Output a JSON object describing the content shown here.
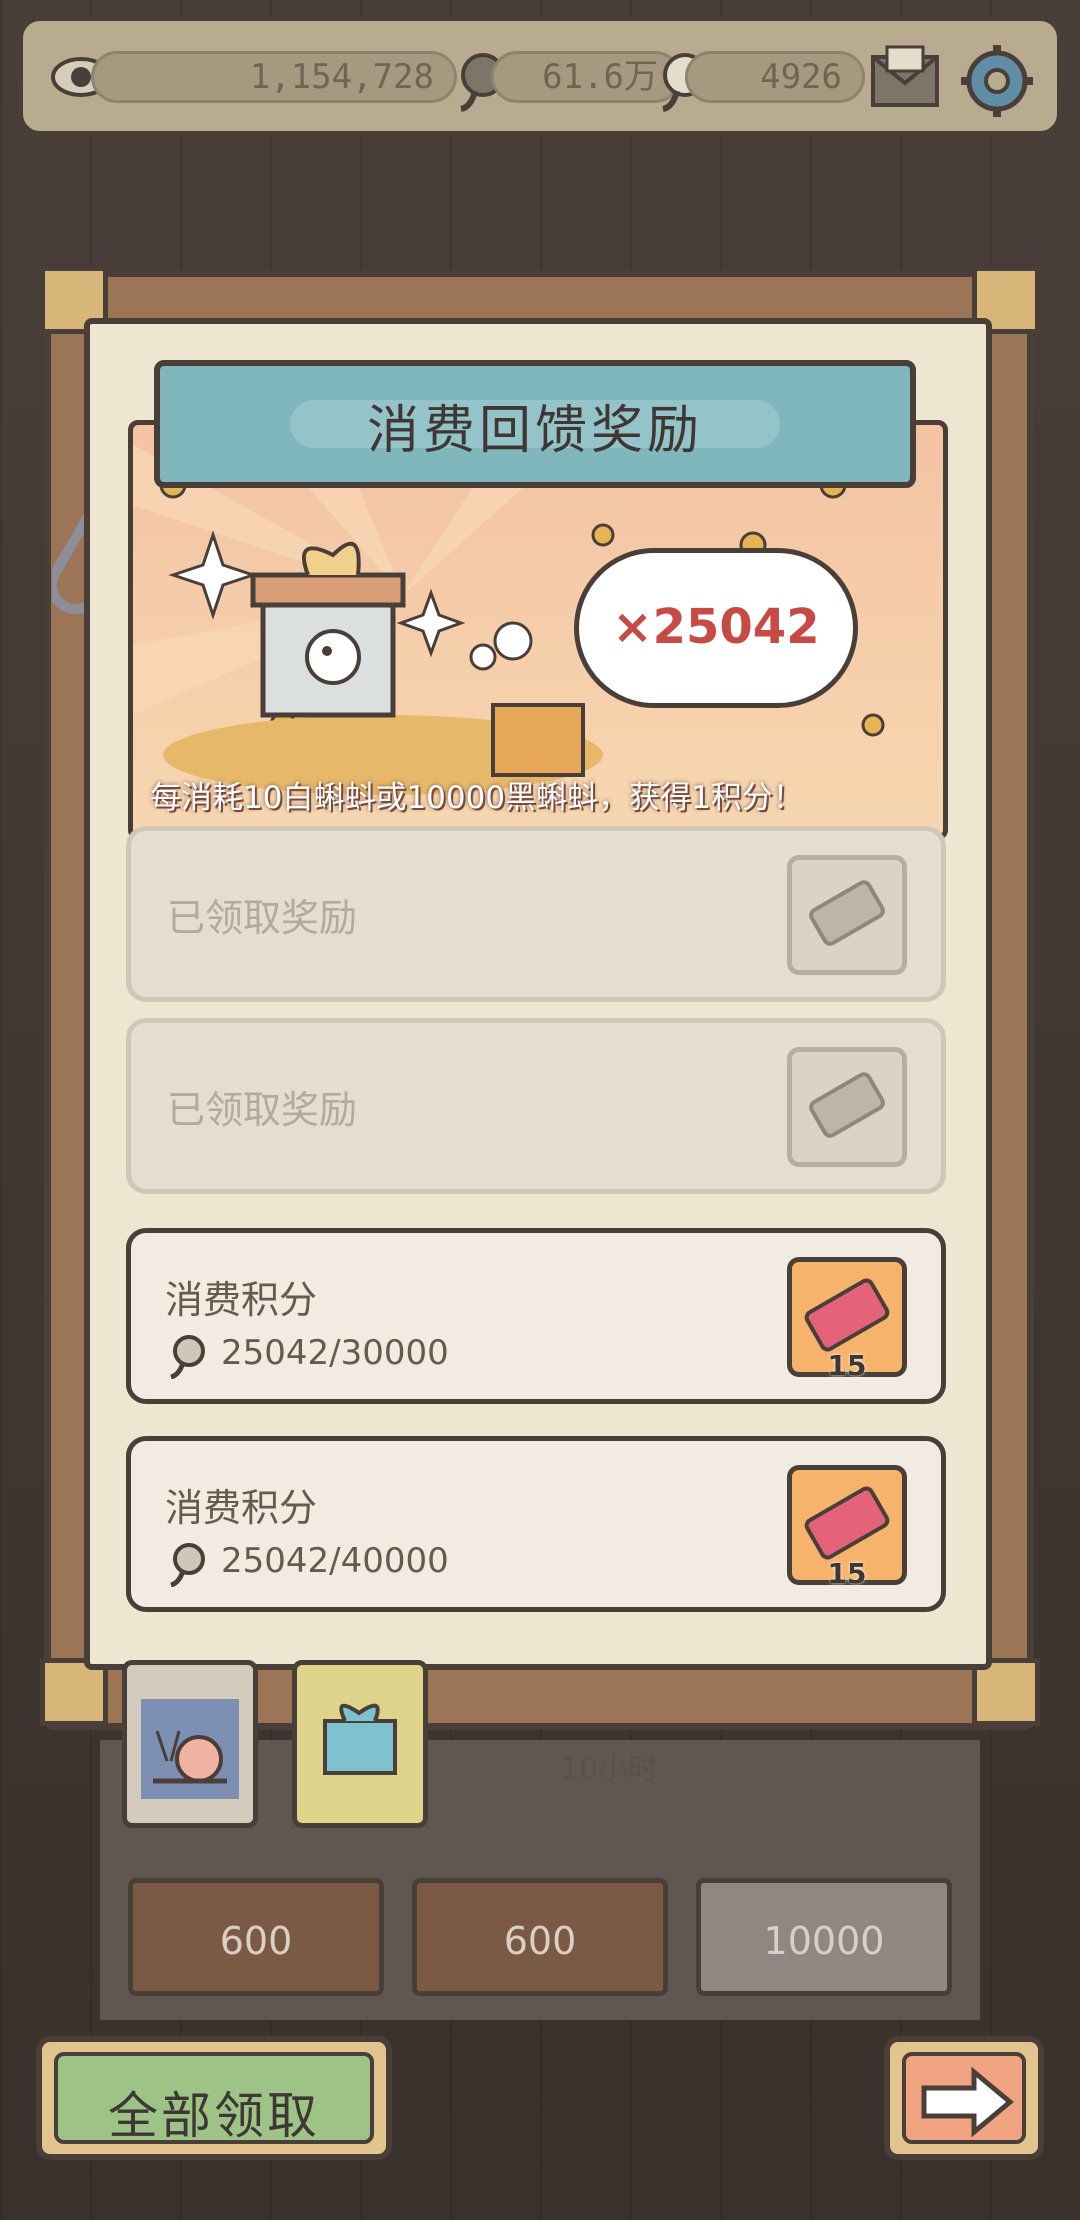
{
  "topbar": {
    "views": "1,154,728",
    "black_tadpoles": "61.6万",
    "white_tadpoles": "4926"
  },
  "panel": {
    "title": "消费回馈奖励",
    "points_total": "×25042",
    "info": "每消耗10白蝌蚪或10000黑蝌蚪，获得1积分！"
  },
  "rows": [
    {
      "label": "已领取奖励"
    },
    {
      "label": "已领取奖励"
    },
    {
      "title": "消费积分",
      "progress": "25042/30000",
      "reward_count": "15"
    },
    {
      "title": "消费积分",
      "progress": "25042/40000",
      "reward_count": "15"
    }
  ],
  "lower": {
    "timer": "10小时",
    "chests": [
      "600",
      "600",
      "10000"
    ]
  },
  "buttons": {
    "claim_all": "全部领取"
  },
  "colors": {
    "banner": "#7fb7bd",
    "claim_all": "#9dc486",
    "next": "#f1a482",
    "ticket_bg": "#f5b36c",
    "cloud_text": "#c84a45"
  }
}
